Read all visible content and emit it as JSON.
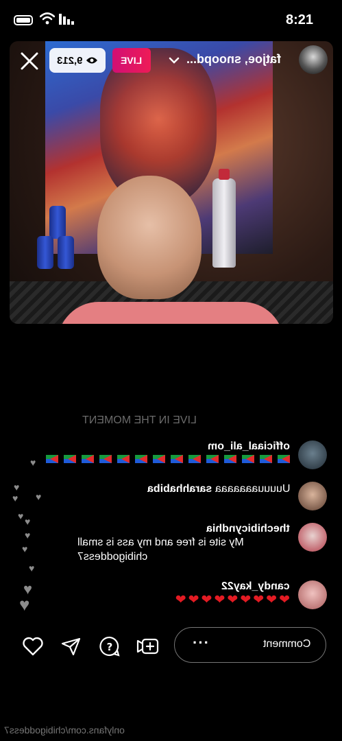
{
  "status_bar": {
    "time": "8:21"
  },
  "header": {
    "viewer_count": "9,213",
    "live_label": "LIVE",
    "host_name": "fatjoe, snoopd..."
  },
  "live_moment_text": "LIVE IN THE MOMENT",
  "comments": [
    {
      "user": "officiaal_ali_om",
      "message": "🇪🇷🇪🇷🇪🇷🇪🇷🇪🇷🇪🇷🇪🇷🇪🇷🇪🇷🇪🇷🇪🇷🇪🇷🇪🇷🇪🇷",
      "avatar_color": "#3a4a5a"
    },
    {
      "user": "sarahhabiba",
      "message": "Uuuuuaaaaaaa",
      "avatar_color": "#8a6a55"
    },
    {
      "user": "thechibicyndhia",
      "message": "My site is free and my ass is small chibigoddess7",
      "avatar_color": "#b04050"
    },
    {
      "user": "candy_kay22",
      "message": "❤️❤️❤️❤️❤️❤️❤️❤️❤️",
      "avatar_color": "#d47a78"
    }
  ],
  "comment_field": {
    "placeholder": "Comment",
    "more": "···"
  },
  "icons": {
    "close": "close-icon",
    "eye": "eye-icon",
    "chevron": "chevron-down-icon",
    "heart": "heart-icon",
    "send": "send-icon",
    "question": "question-icon",
    "add_video": "add-video-icon"
  },
  "watermark": "onlyfans.com/chibigoddess7",
  "colors": {
    "live_badge": "#e3115d",
    "background": "#000000"
  }
}
